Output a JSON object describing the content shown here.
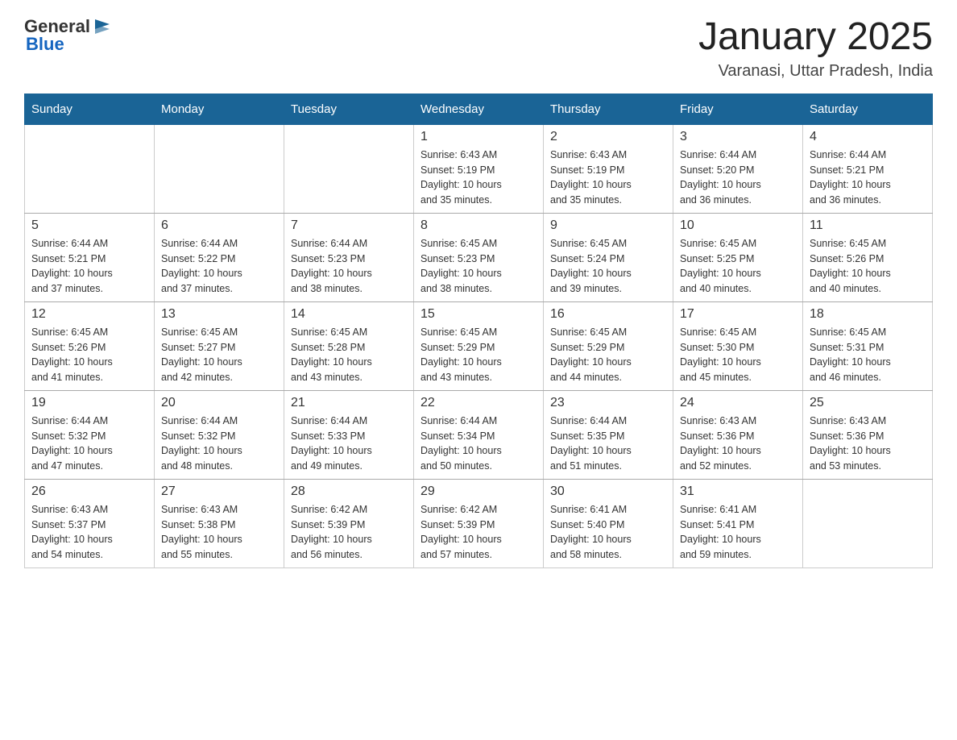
{
  "header": {
    "logo_general": "General",
    "logo_blue": "Blue",
    "title": "January 2025",
    "subtitle": "Varanasi, Uttar Pradesh, India"
  },
  "days_of_week": [
    "Sunday",
    "Monday",
    "Tuesday",
    "Wednesday",
    "Thursday",
    "Friday",
    "Saturday"
  ],
  "weeks": [
    [
      {
        "day": "",
        "info": ""
      },
      {
        "day": "",
        "info": ""
      },
      {
        "day": "",
        "info": ""
      },
      {
        "day": "1",
        "info": "Sunrise: 6:43 AM\nSunset: 5:19 PM\nDaylight: 10 hours\nand 35 minutes."
      },
      {
        "day": "2",
        "info": "Sunrise: 6:43 AM\nSunset: 5:19 PM\nDaylight: 10 hours\nand 35 minutes."
      },
      {
        "day": "3",
        "info": "Sunrise: 6:44 AM\nSunset: 5:20 PM\nDaylight: 10 hours\nand 36 minutes."
      },
      {
        "day": "4",
        "info": "Sunrise: 6:44 AM\nSunset: 5:21 PM\nDaylight: 10 hours\nand 36 minutes."
      }
    ],
    [
      {
        "day": "5",
        "info": "Sunrise: 6:44 AM\nSunset: 5:21 PM\nDaylight: 10 hours\nand 37 minutes."
      },
      {
        "day": "6",
        "info": "Sunrise: 6:44 AM\nSunset: 5:22 PM\nDaylight: 10 hours\nand 37 minutes."
      },
      {
        "day": "7",
        "info": "Sunrise: 6:44 AM\nSunset: 5:23 PM\nDaylight: 10 hours\nand 38 minutes."
      },
      {
        "day": "8",
        "info": "Sunrise: 6:45 AM\nSunset: 5:23 PM\nDaylight: 10 hours\nand 38 minutes."
      },
      {
        "day": "9",
        "info": "Sunrise: 6:45 AM\nSunset: 5:24 PM\nDaylight: 10 hours\nand 39 minutes."
      },
      {
        "day": "10",
        "info": "Sunrise: 6:45 AM\nSunset: 5:25 PM\nDaylight: 10 hours\nand 40 minutes."
      },
      {
        "day": "11",
        "info": "Sunrise: 6:45 AM\nSunset: 5:26 PM\nDaylight: 10 hours\nand 40 minutes."
      }
    ],
    [
      {
        "day": "12",
        "info": "Sunrise: 6:45 AM\nSunset: 5:26 PM\nDaylight: 10 hours\nand 41 minutes."
      },
      {
        "day": "13",
        "info": "Sunrise: 6:45 AM\nSunset: 5:27 PM\nDaylight: 10 hours\nand 42 minutes."
      },
      {
        "day": "14",
        "info": "Sunrise: 6:45 AM\nSunset: 5:28 PM\nDaylight: 10 hours\nand 43 minutes."
      },
      {
        "day": "15",
        "info": "Sunrise: 6:45 AM\nSunset: 5:29 PM\nDaylight: 10 hours\nand 43 minutes."
      },
      {
        "day": "16",
        "info": "Sunrise: 6:45 AM\nSunset: 5:29 PM\nDaylight: 10 hours\nand 44 minutes."
      },
      {
        "day": "17",
        "info": "Sunrise: 6:45 AM\nSunset: 5:30 PM\nDaylight: 10 hours\nand 45 minutes."
      },
      {
        "day": "18",
        "info": "Sunrise: 6:45 AM\nSunset: 5:31 PM\nDaylight: 10 hours\nand 46 minutes."
      }
    ],
    [
      {
        "day": "19",
        "info": "Sunrise: 6:44 AM\nSunset: 5:32 PM\nDaylight: 10 hours\nand 47 minutes."
      },
      {
        "day": "20",
        "info": "Sunrise: 6:44 AM\nSunset: 5:32 PM\nDaylight: 10 hours\nand 48 minutes."
      },
      {
        "day": "21",
        "info": "Sunrise: 6:44 AM\nSunset: 5:33 PM\nDaylight: 10 hours\nand 49 minutes."
      },
      {
        "day": "22",
        "info": "Sunrise: 6:44 AM\nSunset: 5:34 PM\nDaylight: 10 hours\nand 50 minutes."
      },
      {
        "day": "23",
        "info": "Sunrise: 6:44 AM\nSunset: 5:35 PM\nDaylight: 10 hours\nand 51 minutes."
      },
      {
        "day": "24",
        "info": "Sunrise: 6:43 AM\nSunset: 5:36 PM\nDaylight: 10 hours\nand 52 minutes."
      },
      {
        "day": "25",
        "info": "Sunrise: 6:43 AM\nSunset: 5:36 PM\nDaylight: 10 hours\nand 53 minutes."
      }
    ],
    [
      {
        "day": "26",
        "info": "Sunrise: 6:43 AM\nSunset: 5:37 PM\nDaylight: 10 hours\nand 54 minutes."
      },
      {
        "day": "27",
        "info": "Sunrise: 6:43 AM\nSunset: 5:38 PM\nDaylight: 10 hours\nand 55 minutes."
      },
      {
        "day": "28",
        "info": "Sunrise: 6:42 AM\nSunset: 5:39 PM\nDaylight: 10 hours\nand 56 minutes."
      },
      {
        "day": "29",
        "info": "Sunrise: 6:42 AM\nSunset: 5:39 PM\nDaylight: 10 hours\nand 57 minutes."
      },
      {
        "day": "30",
        "info": "Sunrise: 6:41 AM\nSunset: 5:40 PM\nDaylight: 10 hours\nand 58 minutes."
      },
      {
        "day": "31",
        "info": "Sunrise: 6:41 AM\nSunset: 5:41 PM\nDaylight: 10 hours\nand 59 minutes."
      },
      {
        "day": "",
        "info": ""
      }
    ]
  ]
}
